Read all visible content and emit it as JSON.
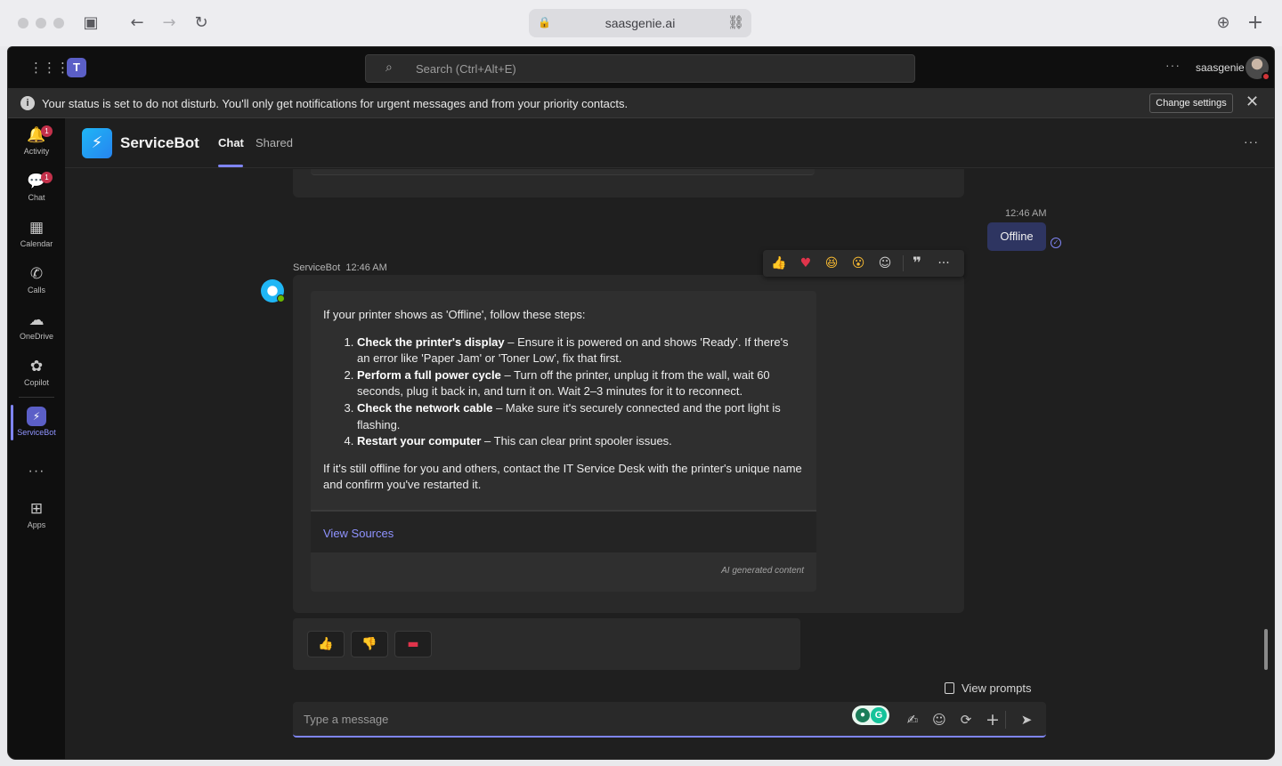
{
  "browser": {
    "url": "saasgenie.ai",
    "icons": {
      "sidebar": "sidebar-toggle-icon",
      "back": "back-arrow-icon",
      "forward": "forward-arrow-icon",
      "reload": "reload-icon",
      "lock": "lock-icon",
      "link": "link-icon",
      "download": "download-icon",
      "new_tab": "plus-icon"
    }
  },
  "topbar": {
    "search_placeholder": "Search (Ctrl+Alt+E)",
    "more": "···",
    "user_name": "saasgenie"
  },
  "notice": {
    "text": "Your status is set to do not disturb. You'll only get notifications for urgent messages and from your priority contacts.",
    "change_settings": "Change settings"
  },
  "rail": {
    "items": [
      {
        "label": "Activity",
        "badge": "1"
      },
      {
        "label": "Chat",
        "badge": "1"
      },
      {
        "label": "Calendar"
      },
      {
        "label": "Calls"
      },
      {
        "label": "OneDrive"
      },
      {
        "label": "Copilot"
      },
      {
        "label": "ServiceBot"
      },
      {
        "label": "Apps"
      }
    ],
    "more": "···"
  },
  "header": {
    "title": "ServiceBot",
    "tabs": [
      {
        "label": "Chat",
        "active": true
      },
      {
        "label": "Shared",
        "active": false
      }
    ],
    "more": "···"
  },
  "conversation": {
    "user_message": {
      "time": "12:46 AM",
      "text": "Offline"
    },
    "bot_message": {
      "sender": "ServiceBot",
      "time": "12:46 AM",
      "intro": "If your printer shows as 'Offline', follow these steps:",
      "steps": [
        {
          "title": "Check the printer's display",
          "text": " – Ensure it is powered on and shows 'Ready'. If there's an error like 'Paper Jam' or 'Toner Low', fix that first."
        },
        {
          "title": "Perform a full power cycle",
          "text": " – Turn off the printer, unplug it from the wall, wait 60 seconds, plug it back in, and turn it on. Wait 2–3 minutes for it to reconnect."
        },
        {
          "title": "Check the network cable",
          "text": " – Make sure it's securely connected and the port light is flashing."
        },
        {
          "title": "Restart your computer",
          "text": " – This can clear print spooler issues."
        }
      ],
      "outro": "If it's still offline for you and others, contact the IT Service Desk with the printer's unique name and confirm you've restarted it.",
      "view_sources": "View Sources",
      "ai_label": "AI generated content"
    },
    "reactions": [
      "thumbs-up-icon",
      "heart-icon",
      "laugh-icon",
      "surprised-icon",
      "add-reaction-icon",
      "quote-icon"
    ],
    "feedback_buttons": [
      "thumbs-up-icon",
      "thumbs-down-icon",
      "ticket-icon"
    ]
  },
  "composer": {
    "placeholder": "Type a message",
    "view_prompts": "View prompts"
  },
  "colors": {
    "accent": "#7f85f5",
    "teams_purple": "#5b5fc7",
    "bot_blue": "#1fb6f5",
    "badge_red": "#c4314b"
  }
}
